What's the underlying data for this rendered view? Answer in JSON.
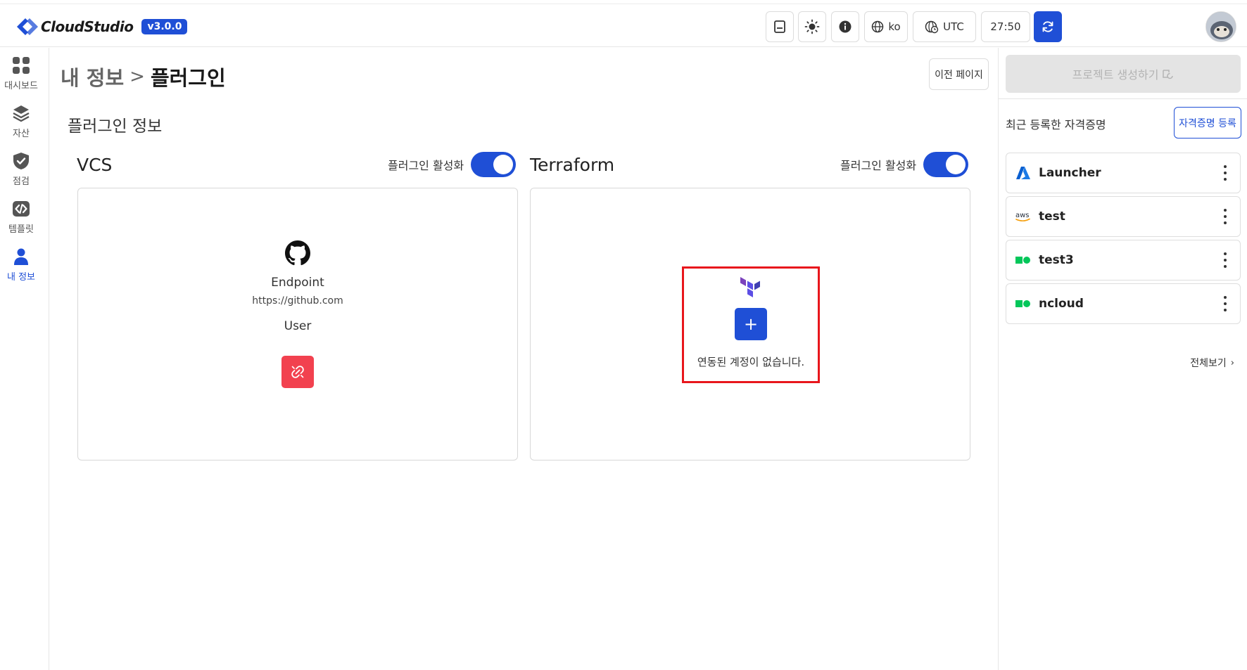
{
  "app": {
    "name": "CloudStudio",
    "version": "v3.0.0"
  },
  "header": {
    "language": "ko",
    "timezone": "UTC",
    "timer": "27:50"
  },
  "sidebar": {
    "items": [
      {
        "label": "대시보드",
        "icon": "dashboard-icon"
      },
      {
        "label": "자산",
        "icon": "layers-icon"
      },
      {
        "label": "점검",
        "icon": "shield-check-icon"
      },
      {
        "label": "템플릿",
        "icon": "code-icon"
      },
      {
        "label": "내 정보",
        "icon": "user-icon",
        "active": true
      }
    ]
  },
  "main": {
    "breadcrumb": {
      "parent": "내 정보",
      "separator": ">",
      "current": "플러그인"
    },
    "back_label": "이전 페이지",
    "section_title": "플러그인 정보",
    "vcs": {
      "title": "VCS",
      "toggle_label": "플러그인 활성화",
      "endpoint_label": "Endpoint",
      "endpoint_url": "https://github.com",
      "user_label": "User"
    },
    "terraform": {
      "title": "Terraform",
      "toggle_label": "플러그인 활성화",
      "add_symbol": "+",
      "empty_text": "연동된 계정이 없습니다."
    }
  },
  "right_panel": {
    "create_project_label": "프로젝트 생성하기",
    "credentials_title": "최근 등록한 자격증명",
    "register_label": "자격증명 등록",
    "credentials": [
      {
        "name": "Launcher",
        "provider": "azure"
      },
      {
        "name": "test",
        "provider": "aws"
      },
      {
        "name": "test3",
        "provider": "ncloud"
      },
      {
        "name": "ncloud",
        "provider": "ncloud"
      }
    ],
    "view_all_label": "전체보기",
    "view_all_chevron": "›"
  },
  "colors": {
    "primary": "#1f4fd6",
    "danger": "#f2414f",
    "highlight": "#e8161c",
    "terraform": "#5c4ee5",
    "ncloud": "#03c75a"
  }
}
